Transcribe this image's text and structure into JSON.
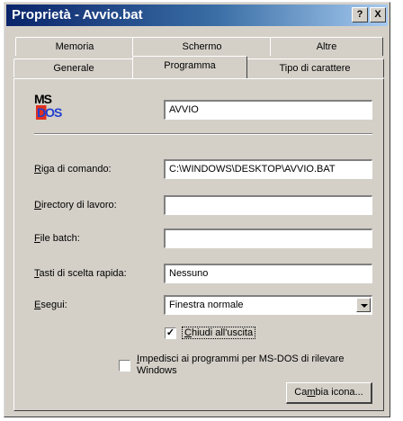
{
  "window": {
    "title": "Proprietà - Avvio.bat",
    "help_label": "?",
    "close_label": "X"
  },
  "tabs_back": [
    {
      "label": "Memoria"
    },
    {
      "label": "Schermo"
    },
    {
      "label": "Altre"
    }
  ],
  "tabs_front": [
    {
      "label": "Generale"
    },
    {
      "label": "Programma",
      "active": true
    },
    {
      "label": "Tipo di carattere"
    }
  ],
  "program": {
    "icon_name": "ms-dos-icon",
    "icon_text_top": "MS",
    "icon_text_bottom": "DOS",
    "name": "AVVIO"
  },
  "fields": {
    "command_line": {
      "label_u": "R",
      "label_rest": "iga di comando:",
      "value": "C:\\WINDOWS\\DESKTOP\\AVVIO.BAT"
    },
    "working_dir": {
      "label_u": "D",
      "label_rest": "irectory di lavoro:",
      "value": ""
    },
    "batch_file": {
      "label_u": "F",
      "label_rest": "ile batch:",
      "value": ""
    },
    "shortcut_key": {
      "label_u": "T",
      "label_rest": "asti di scelta rapida:",
      "value": "Nessuno"
    },
    "run": {
      "label_u": "E",
      "label_rest": "segui:",
      "value": "Finestra normale"
    }
  },
  "options": {
    "close_on_exit": {
      "checked": true,
      "check_mark": "✓",
      "label_u": "C",
      "label_rest": "hiudi all'uscita"
    },
    "prevent_detect": {
      "checked": false,
      "label_u": "I",
      "label_rest": "mpedisci ai programmi per MS-DOS di rilevare",
      "label_line2": "Windows"
    }
  },
  "buttons": {
    "change_icon_pre": "Ca",
    "change_icon_u": "m",
    "change_icon_post": "bia icona..."
  },
  "colors": {
    "face": "#d4d0c8",
    "title_start": "#0a246a",
    "title_end": "#a6caf0"
  }
}
